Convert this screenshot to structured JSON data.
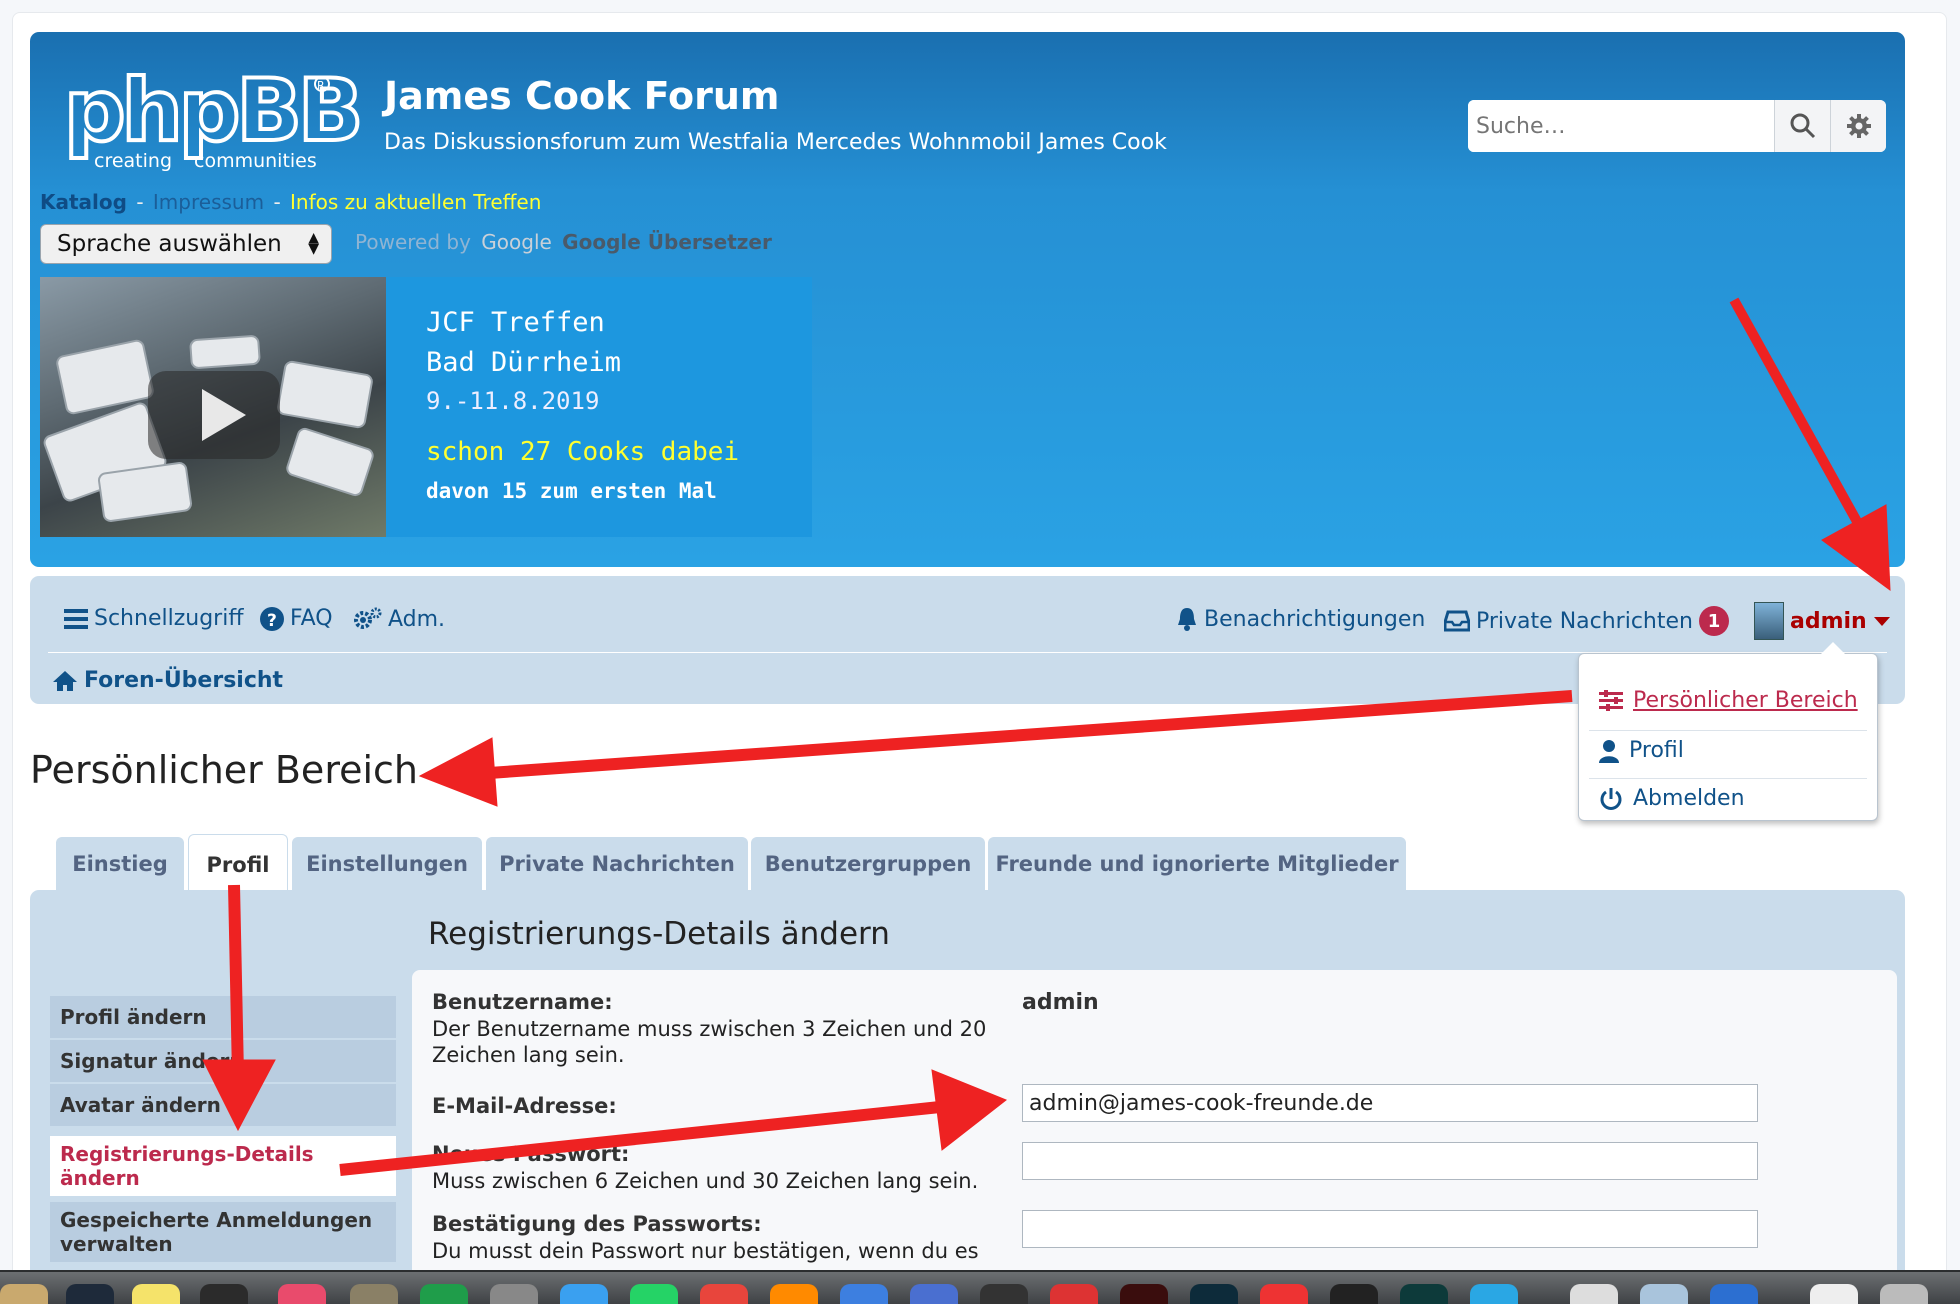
{
  "site": {
    "title": "James Cook Forum",
    "description": "Das Diskussionsforum zum Westfalia Mercedes Wohnmobil James Cook",
    "logo_text": "phpBB",
    "logo_tagline_left": "creating",
    "logo_tagline_right": "communities"
  },
  "search": {
    "placeholder": "Suche…"
  },
  "header_links": {
    "katalog": "Katalog",
    "sep": "-",
    "impressum": "Impressum",
    "infos": "Infos zu aktuellen Treffen"
  },
  "translate": {
    "select_label": "Sprache auswählen",
    "powered_by": "Powered by",
    "google_logo": "Google",
    "service": "Google Übersetzer"
  },
  "banner": {
    "line1": "JCF Treffen",
    "line2": "Bad Dürrheim",
    "line3": "9.-11.8.2019",
    "line4": "schon 27 Cooks dabei",
    "line5": "davon 15 zum ersten Mal"
  },
  "nav": {
    "quick": "Schnellzugriff",
    "faq": "FAQ",
    "acp": "Adm.",
    "notifications": "Benachrichtigungen",
    "pm": "Private Nachrichten",
    "pm_count": "1",
    "user": "admin",
    "breadcrumb": "Foren-Übersicht"
  },
  "user_menu": {
    "items": [
      "Persönlicher Bereich",
      "Profil",
      "Abmelden"
    ]
  },
  "page_title": "Persönlicher Bereich",
  "tabs": [
    "Einstieg",
    "Profil",
    "Einstellungen",
    "Private Nachrichten",
    "Benutzergruppen",
    "Freunde und ignorierte Mitglieder"
  ],
  "active_tab": "Profil",
  "sidebar": {
    "items": [
      "Profil ändern",
      "Signatur ändern",
      "Avatar ändern",
      "Registrierungs-Details ändern",
      "Gespeicherte Anmeldungen verwalten"
    ]
  },
  "form": {
    "title": "Registrierungs-Details ändern",
    "username_label": "Benutzername:",
    "username_explain": "Der Benutzername muss zwischen 3 Zeichen und 20 Zeichen lang sein.",
    "username_value": "admin",
    "email_label": "E-Mail-Adresse:",
    "email_value": "admin@james-cook-freunde.de",
    "newpass_label": "Neues Passwort:",
    "newpass_explain": "Muss zwischen 6 Zeichen und 30 Zeichen lang sein.",
    "confirm_label": "Bestätigung des Passworts:",
    "confirm_explain": "Du musst dein Passwort nur bestätigen, wenn du es"
  },
  "colors": {
    "header_blue": "#2590d4",
    "nav_bg": "#cadceb",
    "link": "#105289",
    "active_red": "#bc2a4d",
    "annotation": "#ee2222"
  }
}
